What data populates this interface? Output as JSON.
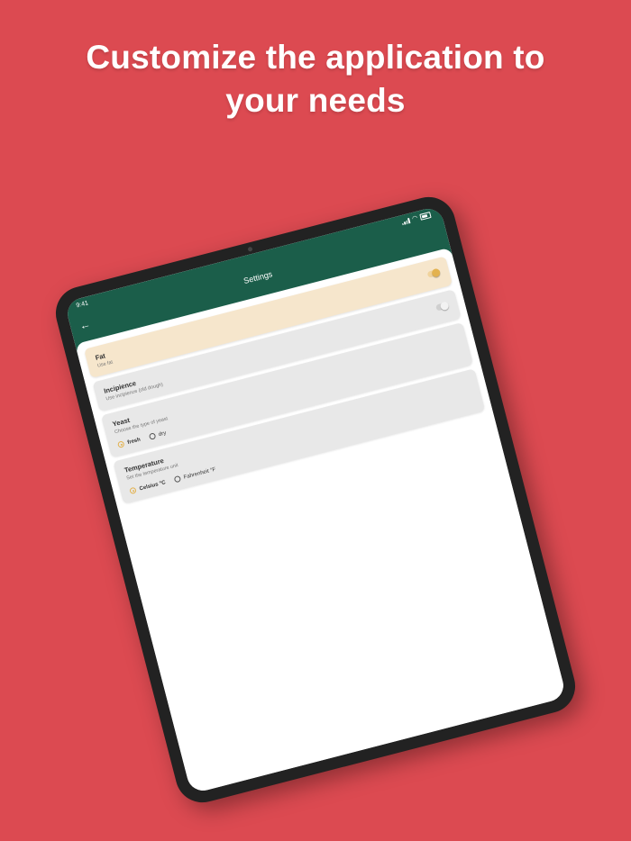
{
  "headline": {
    "line1": "Customize the application to",
    "line2": "your needs"
  },
  "colors": {
    "background": "#dc4a51",
    "appbar": "#1b5e4a",
    "accent": "#e3b24f",
    "highlight_card": "#f6e6cc"
  },
  "status_bar": {
    "time": "9:41"
  },
  "appbar": {
    "back_icon": "arrow-left-icon",
    "title": "Settings"
  },
  "settings": {
    "fat": {
      "title": "Fat",
      "subtitle": "Use fat",
      "enabled": true
    },
    "incipience": {
      "title": "Incipience",
      "subtitle": "Use incipience (old dough)",
      "enabled": false
    },
    "yeast": {
      "title": "Yeast",
      "subtitle": "Choose the type of yeast",
      "options": [
        "fresh",
        "dry"
      ],
      "selected": "fresh"
    },
    "temperature": {
      "title": "Temperature",
      "subtitle": "Set the temperature unit",
      "options": [
        "Celsius °C",
        "Fahrenheit °F"
      ],
      "selected": "Celsius °C"
    }
  }
}
